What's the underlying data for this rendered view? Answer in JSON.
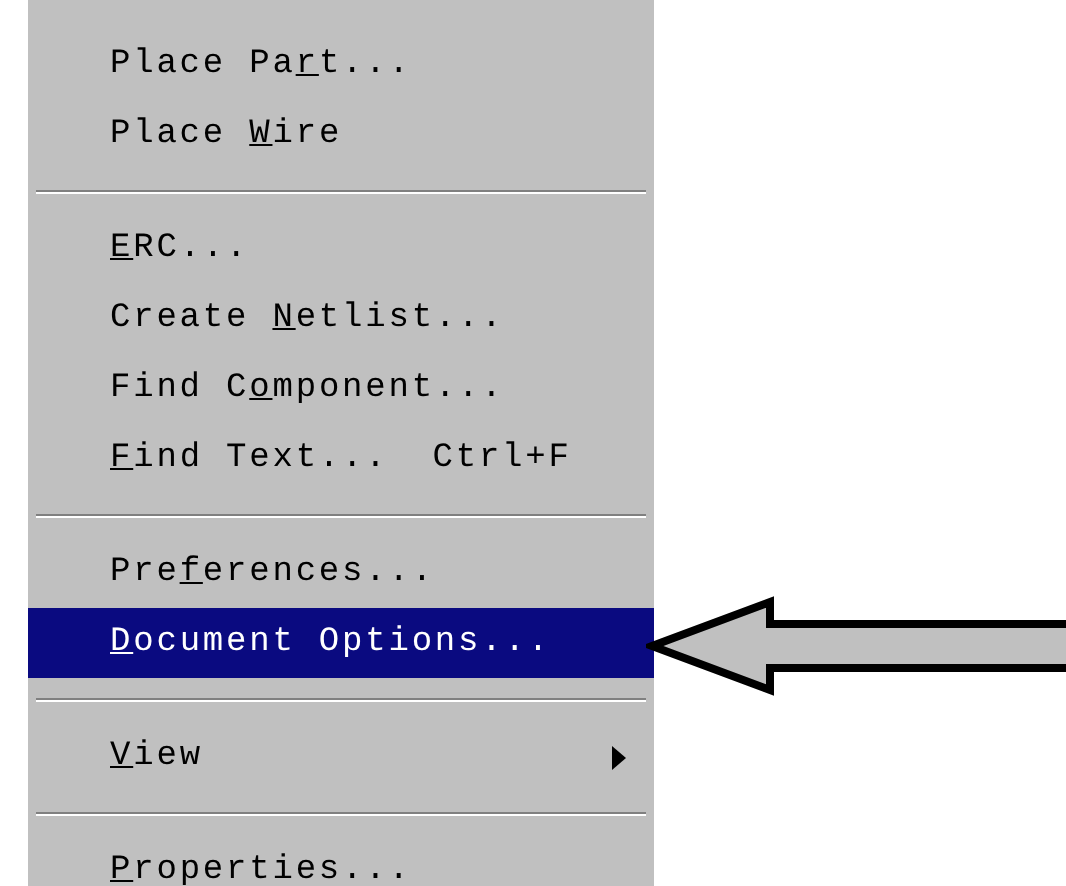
{
  "menu": [
    {
      "kind": "item",
      "label": [
        {
          "text": "Place Pa",
          "underlined": false
        },
        {
          "text": "r",
          "underlined": true
        },
        {
          "text": "t...",
          "underlined": false
        }
      ],
      "selected": false
    },
    {
      "kind": "item",
      "label": [
        {
          "text": "Place ",
          "underlined": false
        },
        {
          "text": "W",
          "underlined": true
        },
        {
          "text": "ire",
          "underlined": false
        }
      ],
      "selected": false
    },
    {
      "kind": "separator"
    },
    {
      "kind": "item",
      "label": [
        {
          "text": "E",
          "underlined": true
        },
        {
          "text": "RC...",
          "underlined": false
        }
      ],
      "selected": false
    },
    {
      "kind": "item",
      "label": [
        {
          "text": "Create ",
          "underlined": false
        },
        {
          "text": "N",
          "underlined": true
        },
        {
          "text": "etlist...",
          "underlined": false
        }
      ],
      "selected": false
    },
    {
      "kind": "item",
      "label": [
        {
          "text": "Find C",
          "underlined": false
        },
        {
          "text": "o",
          "underlined": true
        },
        {
          "text": "mponent...",
          "underlined": false
        }
      ],
      "selected": false
    },
    {
      "kind": "item",
      "label": [
        {
          "text": "F",
          "underlined": true
        },
        {
          "text": "ind Text...",
          "underlined": false
        }
      ],
      "shortcut": "Ctrl+F",
      "selected": false
    },
    {
      "kind": "separator"
    },
    {
      "kind": "item",
      "label": [
        {
          "text": "Pre",
          "underlined": false
        },
        {
          "text": "f",
          "underlined": true
        },
        {
          "text": "erences...",
          "underlined": false
        }
      ],
      "selected": false
    },
    {
      "kind": "item",
      "label": [
        {
          "text": "D",
          "underlined": true
        },
        {
          "text": "ocument Options...",
          "underlined": false
        }
      ],
      "selected": true
    },
    {
      "kind": "separator"
    },
    {
      "kind": "item",
      "label": [
        {
          "text": "V",
          "underlined": true
        },
        {
          "text": "iew",
          "underlined": false
        }
      ],
      "submenu": true,
      "selected": false
    },
    {
      "kind": "separator"
    },
    {
      "kind": "item",
      "label": [
        {
          "text": "P",
          "underlined": true
        },
        {
          "text": "roperties...",
          "underlined": false
        }
      ],
      "selected": false
    }
  ]
}
